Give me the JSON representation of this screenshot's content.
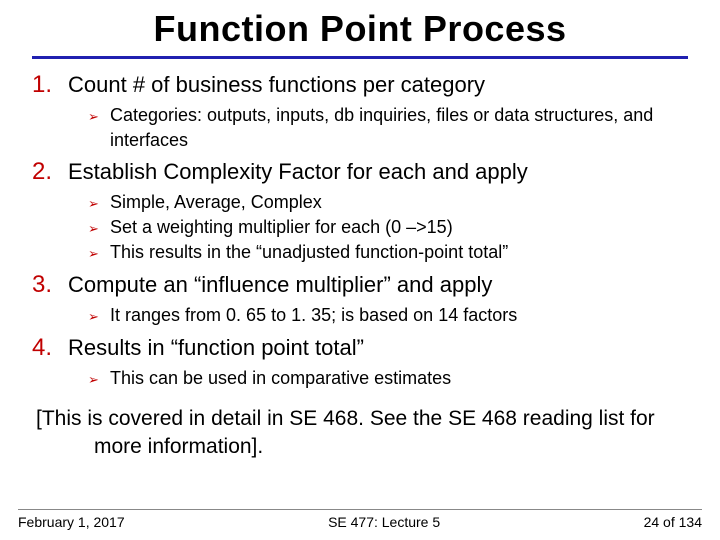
{
  "title": "Function Point Process",
  "items": [
    {
      "num": "1",
      "text": "Count # of business functions per category",
      "subs": [
        "Categories: outputs, inputs, db inquiries, files or data structures, and interfaces"
      ]
    },
    {
      "num": "2",
      "text": "Establish Complexity Factor for each and apply",
      "subs": [
        "Simple, Average, Complex",
        "Set a weighting multiplier for each (0 –>15)",
        "This results in the “unadjusted function-point total”"
      ]
    },
    {
      "num": "3",
      "text": "Compute an “influence multiplier” and apply",
      "subs": [
        "It ranges from 0. 65 to 1. 35; is based on 14 factors"
      ]
    },
    {
      "num": "4",
      "text": "Results in “function point total”",
      "subs": [
        "This can be used in comparative estimates"
      ]
    }
  ],
  "closing": "[This is covered in detail in SE 468. See the SE 468 reading list for more information].",
  "footer": {
    "date": "February 1, 2017",
    "center": "SE 477: Lecture 5",
    "page_current": "24",
    "page_sep": " of ",
    "page_total": "134"
  },
  "bullet_glyph": "➢"
}
